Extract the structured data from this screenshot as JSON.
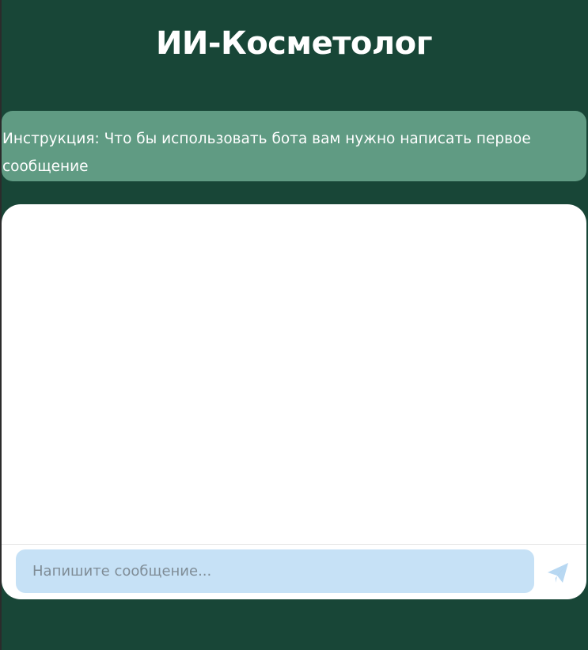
{
  "header": {
    "title": "ИИ-Косметолог"
  },
  "instruction": {
    "text": "Инструкция: Что бы использовать бота вам нужно написать первое сообщение"
  },
  "chat": {
    "input_placeholder": "Напишите сообщение...",
    "send_icon": "send-paper-plane-icon"
  },
  "colors": {
    "background": "#184637",
    "instruction_bg": "#609b83",
    "input_bg": "#c6e1f6",
    "send_icon": "#b8d8f2"
  }
}
